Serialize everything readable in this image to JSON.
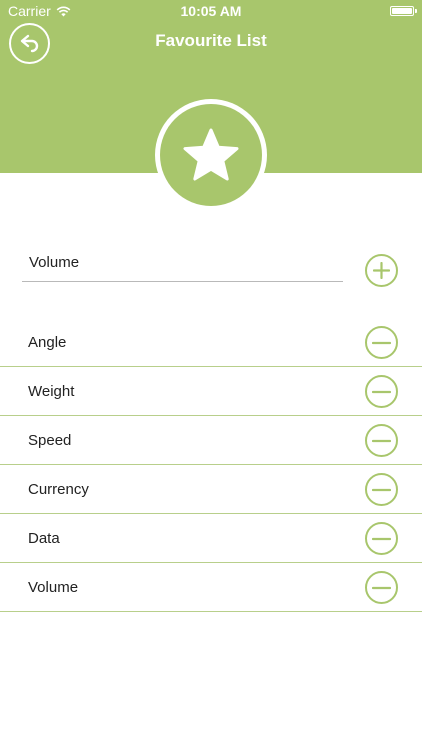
{
  "status_bar": {
    "carrier": "Carrier",
    "time": "10:05 AM"
  },
  "header": {
    "title": "Favourite List",
    "background_color": "#a8c66c",
    "badge_icon": "star-icon",
    "back_icon": "back-arrow-icon"
  },
  "add_row": {
    "input_value": "Volume",
    "add_icon": "plus-circle-icon"
  },
  "favourites": [
    {
      "label": "Angle"
    },
    {
      "label": "Weight"
    },
    {
      "label": "Speed"
    },
    {
      "label": "Currency"
    },
    {
      "label": "Data"
    },
    {
      "label": "Volume"
    }
  ],
  "colors": {
    "accent": "#a8c66c",
    "divider": "#b8cf8b",
    "text": "#222222"
  },
  "remove_icon": "minus-circle-icon"
}
